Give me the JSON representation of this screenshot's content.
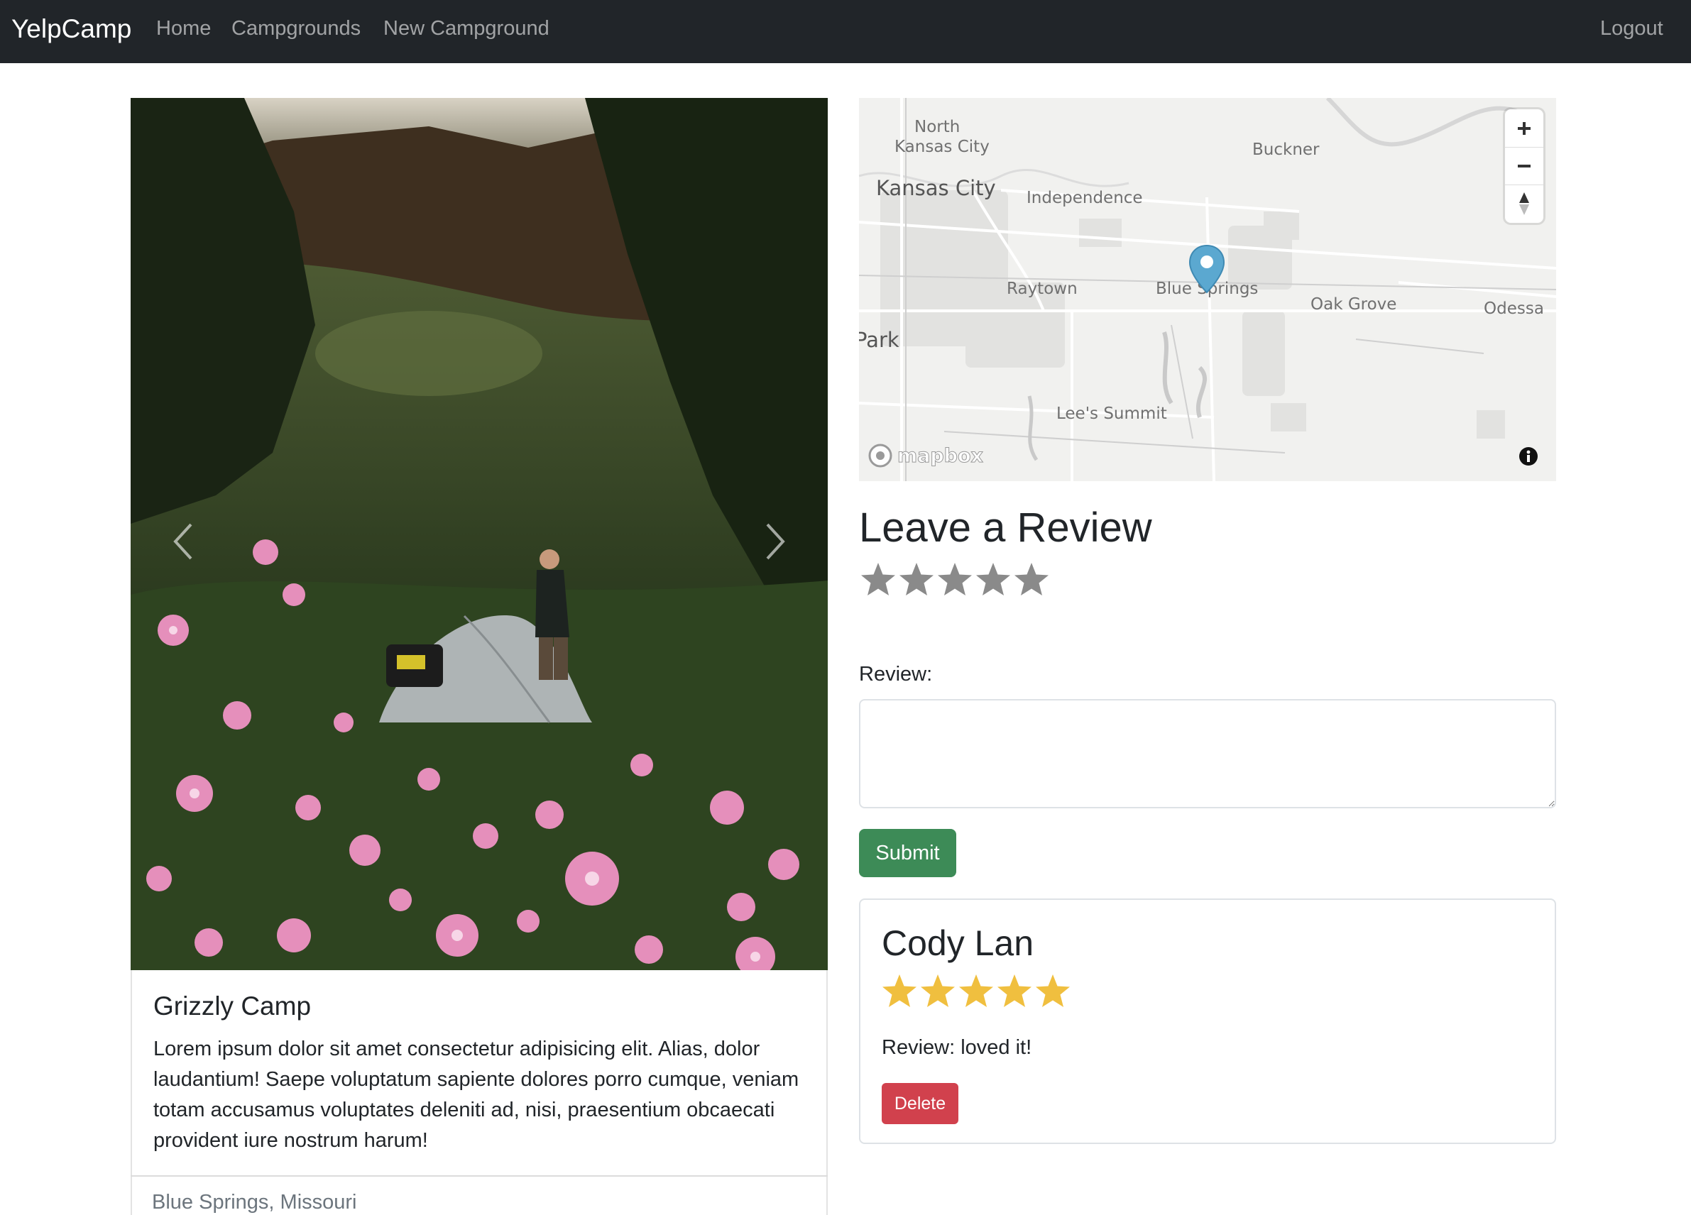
{
  "navbar": {
    "brand": "YelpCamp",
    "links": [
      "Home",
      "Campgrounds",
      "New Campground"
    ],
    "logout": "Logout"
  },
  "campground": {
    "title": "Grizzly Camp",
    "description": "Lorem ipsum dolor sit amet consectetur adipisicing elit. Alias, dolor laudantium! Saepe voluptatum sapiente dolores porro cumque, veniam totam accusamus voluptates deleniti ad, nisi, praesentium obcaecati provident iure nostrum harum!",
    "location": "Blue Springs, Missouri"
  },
  "map": {
    "labels": {
      "north_kc_1": "North",
      "north_kc_2": "Kansas City",
      "kansas_city": "Kansas City",
      "independence": "Independence",
      "buckner": "Buckner",
      "raytown": "Raytown",
      "blue_springs": "Blue Springs",
      "oak_grove": "Oak Grove",
      "odessa": "Odessa",
      "park": "Park",
      "lees_summit": "Lee's Summit"
    },
    "attribution": "mapbox",
    "pin_color": "#5ba8d0"
  },
  "review_form": {
    "heading": "Leave a Review",
    "rating": 0,
    "label": "Review:",
    "value": "",
    "submit_label": "Submit"
  },
  "reviews": [
    {
      "author": "Cody Lan",
      "rating": 5,
      "text": "Review: loved it!",
      "delete_label": "Delete"
    }
  ],
  "colors": {
    "navbar": "#212529",
    "submit": "#3d8b57",
    "delete": "#d1414d",
    "star_filled": "#f0bf3f",
    "star_empty": "#8a8a8a"
  }
}
